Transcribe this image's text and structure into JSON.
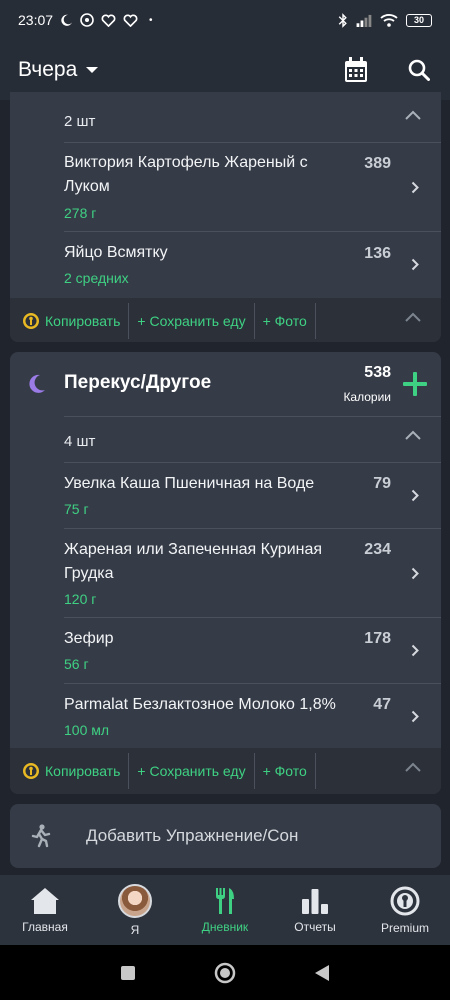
{
  "status_bar": {
    "time": "23:07",
    "dot": "•",
    "battery": "30"
  },
  "app_bar": {
    "title": "Вчера"
  },
  "meal_prev": {
    "count": "2 шт",
    "items": [
      {
        "name": "Виктория Картофель Жареный с Луком",
        "amount": "278 г",
        "calories": "389"
      },
      {
        "name": "Яйцо Всмятку",
        "amount": "2 средних",
        "calories": "136"
      }
    ],
    "actions": {
      "copy": "Копировать",
      "save": "+ Сохранить еду",
      "photo": "+ Фото"
    }
  },
  "meal_snack": {
    "title": "Перекус/Другое",
    "calories": "538",
    "calories_label": "Калории",
    "count": "4 шт",
    "items": [
      {
        "name": "Увелка Каша Пшеничная на Воде",
        "amount": "75 г",
        "calories": "79"
      },
      {
        "name": "Жареная или Запеченная Куриная Грудка",
        "amount": "120 г",
        "calories": "234"
      },
      {
        "name": "Зефир",
        "amount": "56 г",
        "calories": "178"
      },
      {
        "name": "Parmalat Безлактозное Молоко 1,8%",
        "amount": "100 мл",
        "calories": "47"
      }
    ],
    "actions": {
      "copy": "Копировать",
      "save": "+ Сохранить еду",
      "photo": "+ Фото"
    }
  },
  "exercise": {
    "label": "Добавить Упражнение/Сон"
  },
  "bottom_nav": {
    "items": [
      {
        "label": "Главная",
        "icon": "home-icon"
      },
      {
        "label": "Я",
        "icon": "avatar"
      },
      {
        "label": "Дневник",
        "icon": "cutlery-icon"
      },
      {
        "label": "Отчеты",
        "icon": "bar-chart-icon"
      },
      {
        "label": "Premium",
        "icon": "premium-icon"
      }
    ],
    "active": "Дневник"
  },
  "colors": {
    "accent": "#3fd183",
    "background": "#20242c",
    "card": "#353b47",
    "moon": "#9b7be6"
  }
}
